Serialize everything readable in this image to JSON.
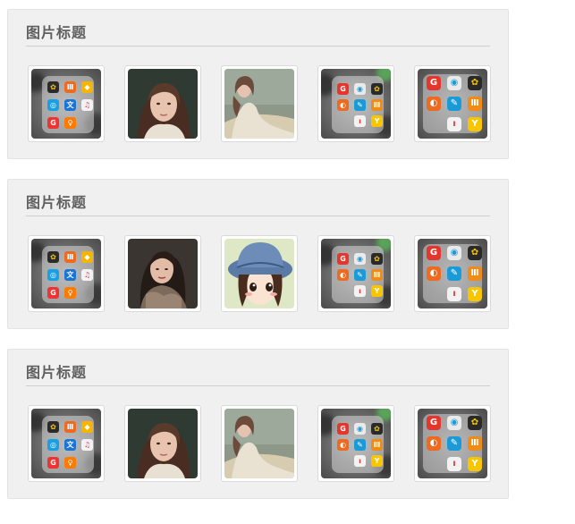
{
  "panels": [
    {
      "title": "图片标题",
      "thumbnails": [
        "app-folder-1",
        "portrait-woman-1",
        "woman-sitting",
        "app-folder-2",
        "app-folder-3"
      ]
    },
    {
      "title": "图片标题",
      "thumbnails": [
        "app-folder-1",
        "portrait-woman-2",
        "cartoon-girl-hat",
        "app-folder-2",
        "app-folder-3"
      ]
    },
    {
      "title": "图片标题",
      "thumbnails": [
        "app-folder-1",
        "portrait-woman-1",
        "woman-sitting",
        "app-folder-2",
        "app-folder-3"
      ]
    }
  ],
  "colors": {
    "panel_bg": "#f0f0f0",
    "title": "#5f5f5f",
    "rule": "#cfcfcf"
  }
}
